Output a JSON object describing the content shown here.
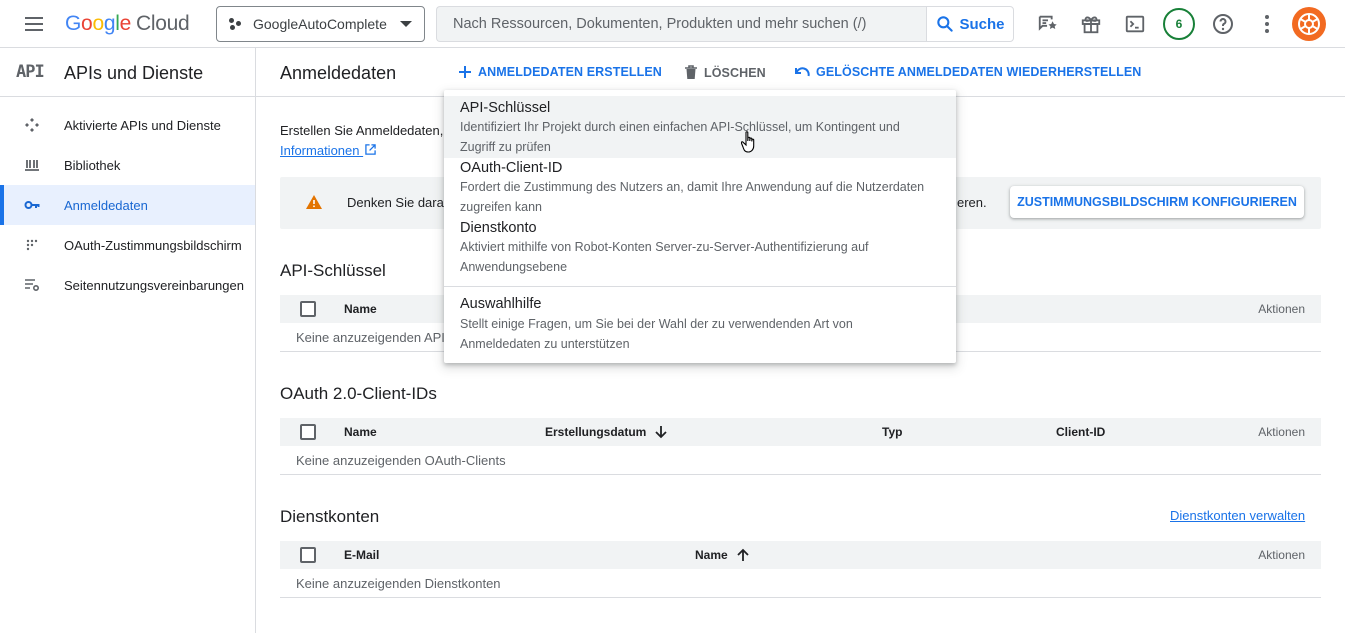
{
  "topbar": {
    "logo": {
      "google": [
        "G",
        "o",
        "o",
        "g",
        "l",
        "e"
      ],
      "cloud": "Cloud"
    },
    "project_name": "GoogleAutoComplete",
    "search_placeholder": "Nach Ressourcen, Dokumenten, Produkten und mehr suchen (/)",
    "search_button": "Suche",
    "notification_count": "6",
    "icons": [
      "menu-icon",
      "project-dots-icon",
      "search-icon",
      "feedback-icon",
      "gift-icon",
      "cloud-shell-icon",
      "help-icon",
      "more-vert-icon",
      "avatar"
    ]
  },
  "sidebar": {
    "mark": "API",
    "title": "APIs und Dienste",
    "items": [
      {
        "label": "Aktivierte APIs und Dienste",
        "icon": "api-nodes-icon",
        "active": false
      },
      {
        "label": "Bibliothek",
        "icon": "library-icon",
        "active": false
      },
      {
        "label": "Anmeldedaten",
        "icon": "key-icon",
        "active": true
      },
      {
        "label": "OAuth-Zustimmungsbildschirm",
        "icon": "consent-dots-icon",
        "active": false
      },
      {
        "label": "Seitennutzungsvereinbarungen",
        "icon": "settings-list-icon",
        "active": false
      }
    ]
  },
  "header": {
    "title": "Anmeldedaten",
    "create": "ANMELDEDATEN ERSTELLEN",
    "delete": "LÖSCHEN",
    "restore": "GELÖSCHTE ANMELDEDATEN WIEDERHERSTELLEN"
  },
  "intro": {
    "text": "Erstellen Sie Anmeldedaten,",
    "link": "Informationen"
  },
  "warning": {
    "text_start": "Denken Sie daran",
    "text_end": "eren.",
    "button": "ZUSTIMMUNGSBILDSCHIRM KONFIGURIEREN"
  },
  "sections": {
    "api_keys": {
      "title": "API-Schlüssel",
      "columns": [
        "Name",
        "Aktionen"
      ],
      "empty": "Keine anzuzeigenden API-"
    },
    "oauth": {
      "title": "OAuth 2.0-Client-IDs",
      "columns": [
        "Name",
        "Erstellungsdatum",
        "Typ",
        "Client-ID",
        "Aktionen"
      ],
      "empty": "Keine anzuzeigenden OAuth-Clients"
    },
    "service_accounts": {
      "title": "Dienstkonten",
      "manage_link": "Dienstkonten verwalten",
      "columns": [
        "E-Mail",
        "Name",
        "Aktionen"
      ],
      "empty": "Keine anzuzeigenden Dienstkonten"
    }
  },
  "dropdown": {
    "items": [
      {
        "title": "API-Schlüssel",
        "desc": "Identifiziert Ihr Projekt durch einen einfachen API-Schlüssel, um Kontingent und Zugriff zu prüfen"
      },
      {
        "title": "OAuth-Client-ID",
        "desc": "Fordert die Zustimmung des Nutzers an, damit Ihre Anwendung auf die Nutzerdaten zugreifen kann"
      },
      {
        "title": "Dienstkonto",
        "desc": "Aktiviert mithilfe von Robot-Konten Server-zu-Server-Authentifizierung auf Anwendungsebene"
      },
      {
        "title": "Auswahlhilfe",
        "desc": "Stellt einige Fragen, um Sie bei der Wahl der zu verwendenden Art von Anmeldedaten zu unterstützen"
      }
    ]
  },
  "colors": {
    "accent": "#1a73e8",
    "warning": "#e37400",
    "badge": "#188038",
    "avatar": "#f26a21"
  }
}
